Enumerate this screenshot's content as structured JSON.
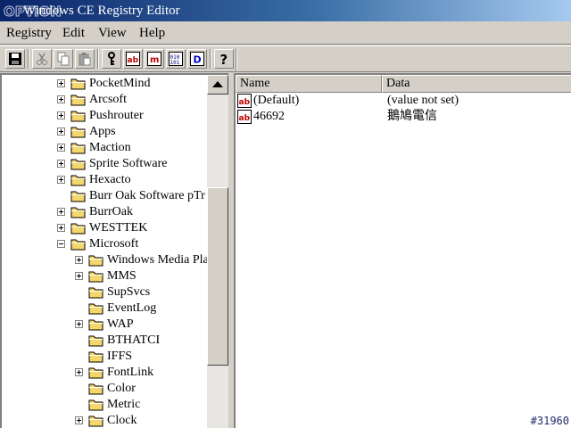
{
  "window": {
    "title": "Windows CE Registry Editor",
    "logo_text": "OPTION"
  },
  "menu": [
    "Registry",
    "Edit",
    "View",
    "Help"
  ],
  "toolbar": {
    "buttons": [
      "save-icon",
      "cut-icon",
      "copy-icon",
      "paste-icon",
      "new-key-icon",
      "new-string-icon",
      "new-multistring-icon",
      "new-binary-icon",
      "new-dword-icon",
      "help-icon"
    ]
  },
  "tree": {
    "items": [
      {
        "label": "PocketMind",
        "expander": "plus"
      },
      {
        "label": "Arcsoft",
        "expander": "plus"
      },
      {
        "label": "Pushrouter",
        "expander": "plus"
      },
      {
        "label": "Apps",
        "expander": "plus"
      },
      {
        "label": "Maction",
        "expander": "plus"
      },
      {
        "label": "Sprite Software",
        "expander": "plus"
      },
      {
        "label": "Hexacto",
        "expander": "plus"
      },
      {
        "label": "Burr Oak Software pTr",
        "expander": "none"
      },
      {
        "label": "BurrOak",
        "expander": "plus"
      },
      {
        "label": "WESTTEK",
        "expander": "plus"
      },
      {
        "label": "Microsoft",
        "expander": "minus"
      },
      {
        "label": "Windows Media Pla",
        "expander": "plus"
      },
      {
        "label": "MMS",
        "expander": "plus"
      },
      {
        "label": "SupSvcs",
        "expander": "none"
      },
      {
        "label": "EventLog",
        "expander": "none"
      },
      {
        "label": "WAP",
        "expander": "plus"
      },
      {
        "label": "BTHATCI",
        "expander": "none"
      },
      {
        "label": "IFFS",
        "expander": "none"
      },
      {
        "label": "FontLink",
        "expander": "plus"
      },
      {
        "label": "Color",
        "expander": "none"
      },
      {
        "label": "Metric",
        "expander": "none"
      },
      {
        "label": "Clock",
        "expander": "plus"
      }
    ]
  },
  "list": {
    "headers": {
      "name": "Name",
      "data": "Data"
    },
    "rows": [
      {
        "name": "(Default)",
        "data": "(value not set)"
      },
      {
        "name": "46692",
        "data": "鵝鳩電信"
      }
    ]
  },
  "watermark": "#31960",
  "colors": {
    "titlebar_start": "#0a246a",
    "titlebar_end": "#a6caf0",
    "face": "#d4d0c8",
    "folder": "#f5d76e"
  }
}
